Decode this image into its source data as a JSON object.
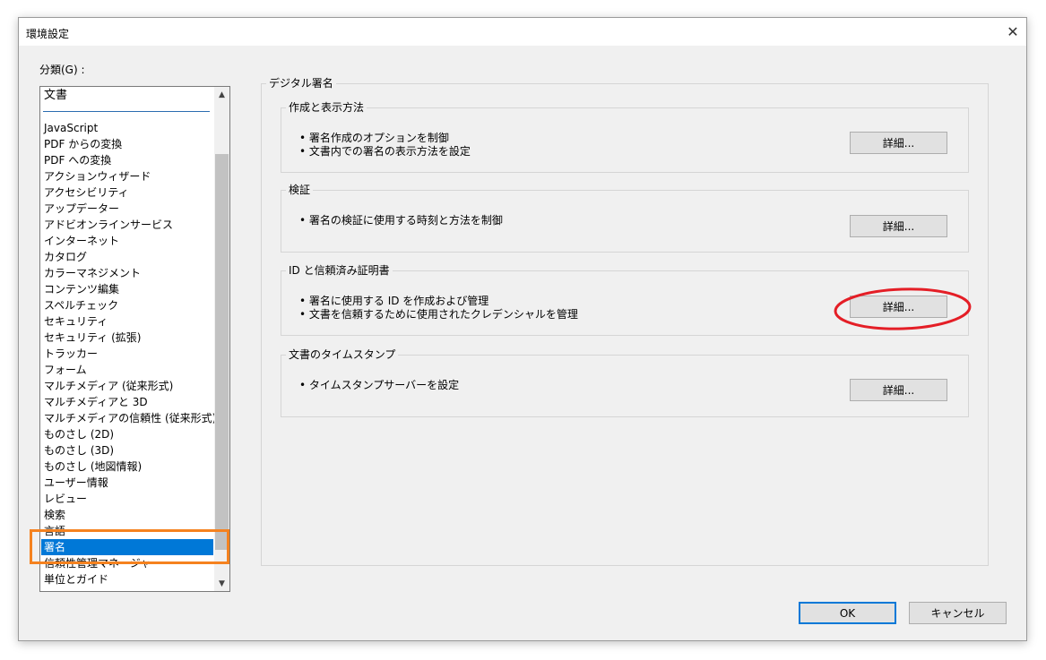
{
  "window": {
    "title": "環境設定",
    "close_glyph": "✕"
  },
  "categories": {
    "label": "分類(G) :",
    "top_item": "文書",
    "items": [
      "JavaScript",
      "PDF からの変換",
      "PDF への変換",
      "アクションウィザード",
      "アクセシビリティ",
      "アップデーター",
      "アドビオンラインサービス",
      "インターネット",
      "カタログ",
      "カラーマネジメント",
      "コンテンツ編集",
      "スペルチェック",
      "セキュリティ",
      "セキュリティ (拡張)",
      "トラッカー",
      "フォーム",
      "マルチメディア (従来形式)",
      "マルチメディアと 3D",
      "マルチメディアの信頼性 (従来形式)",
      "ものさし (2D)",
      "ものさし (3D)",
      "ものさし (地図情報)",
      "ユーザー情報",
      "レビュー",
      "検索",
      "言語",
      "署名",
      "信頼性管理マネージャー",
      "単位とガイド"
    ],
    "selected": "署名",
    "scroll_up_glyph": "▲",
    "scroll_down_glyph": "▼"
  },
  "panel": {
    "title": "デジタル署名",
    "groups": [
      {
        "title": "作成と表示方法",
        "bullets": [
          "• 署名作成のオプションを制御",
          "• 文書内での署名の表示方法を設定"
        ],
        "button": "詳細..."
      },
      {
        "title": "検証",
        "bullets": [
          "• 署名の検証に使用する時刻と方法を制御"
        ],
        "button": "詳細..."
      },
      {
        "title": "ID と信頼済み証明書",
        "bullets": [
          "• 署名に使用する ID を作成および管理",
          "• 文書を信頼するために使用されたクレデンシャルを管理"
        ],
        "button": "詳細..."
      },
      {
        "title": "文書のタイムスタンプ",
        "bullets": [
          "• タイムスタンプサーバーを設定"
        ],
        "button": "詳細..."
      }
    ]
  },
  "footer": {
    "ok": "OK",
    "cancel": "キャンセル"
  },
  "colors": {
    "selection": "#0078d7",
    "highlight_orange": "#f5821f",
    "highlight_red": "#e41e26"
  }
}
